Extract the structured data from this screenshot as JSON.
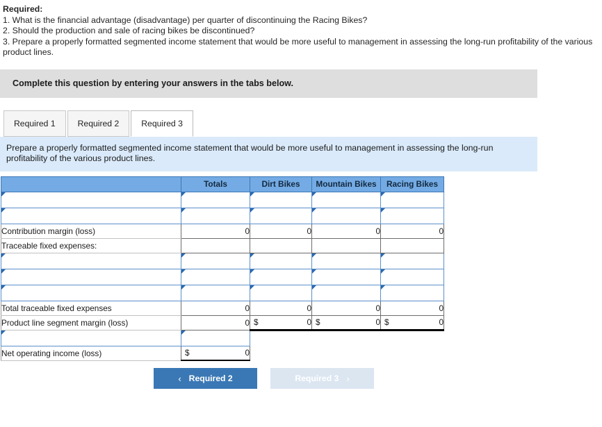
{
  "prompt": {
    "title": "Required:",
    "lines": [
      "1. What is the financial advantage (disadvantage) per quarter of discontinuing the Racing Bikes?",
      "2. Should the production and sale of racing bikes be discontinued?",
      "3. Prepare a properly formatted segmented income statement that would be more useful to management in assessing the long-run profitability of the various product lines."
    ]
  },
  "banner": {
    "text": "Complete this question by entering your answers in the tabs below."
  },
  "tabs": [
    {
      "label": "Required 1",
      "active": false
    },
    {
      "label": "Required 2",
      "active": false
    },
    {
      "label": "Required 3",
      "active": true
    }
  ],
  "instruction": {
    "text": "Prepare a properly formatted segmented income statement that would be more useful to management in assessing the long-run profitability of the various product lines."
  },
  "sheet": {
    "headers": [
      "",
      "Totals",
      "Dirt Bikes",
      "Mountain Bikes",
      "Racing Bikes"
    ],
    "rows": [
      {
        "type": "input",
        "label": "",
        "totals": "",
        "dirt": "",
        "mountain": "",
        "racing": ""
      },
      {
        "type": "input",
        "label": "",
        "totals": "",
        "dirt": "",
        "mountain": "",
        "racing": ""
      },
      {
        "type": "static",
        "label": "Contribution margin (loss)",
        "totals": "0",
        "dirt": "0",
        "mountain": "0",
        "racing": "0"
      },
      {
        "type": "static",
        "label": "Traceable fixed expenses:",
        "totals": "",
        "dirt": "",
        "mountain": "",
        "racing": ""
      },
      {
        "type": "input",
        "label": "",
        "totals": "",
        "dirt": "",
        "mountain": "",
        "racing": ""
      },
      {
        "type": "input",
        "label": "",
        "totals": "",
        "dirt": "",
        "mountain": "",
        "racing": ""
      },
      {
        "type": "input",
        "label": "",
        "totals": "",
        "dirt": "",
        "mountain": "",
        "racing": ""
      },
      {
        "type": "static",
        "label": "Total traceable fixed expenses",
        "totals": "0",
        "dirt": "0",
        "mountain": "0",
        "racing": "0"
      },
      {
        "type": "static",
        "label": "Product line segment margin (loss)",
        "totals": "0",
        "dirt": "0",
        "mountain": "0",
        "racing": "0",
        "dollar": {
          "totals": "",
          "dirt": "$",
          "mountain": "$",
          "racing": "$"
        }
      },
      {
        "type": "input-totals-only",
        "label": "",
        "totals": ""
      },
      {
        "type": "static-totals-only",
        "label": "Net operating income (loss)",
        "totals": "0",
        "dollar": {
          "totals": "$"
        }
      }
    ]
  },
  "nav": {
    "prev_label": "Required 2",
    "prev_chevron": "‹",
    "next_label": "Required 3",
    "next_chevron": "›"
  },
  "colors": {
    "header_blue": "#74abe4",
    "header_border": "#3c78b5",
    "instruction_blue": "#daeafa",
    "banner_gray": "#dedede",
    "button_blue": "#3a78b5",
    "button_disabled": "#dbe6f1",
    "input_border": "#5b8fc9",
    "input_marker": "#2a69ae"
  }
}
